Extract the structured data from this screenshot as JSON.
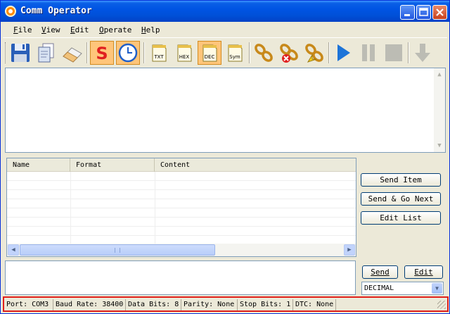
{
  "window": {
    "title": "Comm Operator"
  },
  "menu": [
    "File",
    "View",
    "Edit",
    "Operate",
    "Help"
  ],
  "toolbar": {
    "items": [
      {
        "name": "save-icon"
      },
      {
        "name": "copy-icon"
      },
      {
        "name": "eraser-icon"
      },
      {
        "name": "stop-s-icon",
        "label": "S",
        "active": true
      },
      {
        "name": "timer-clock-icon",
        "active": true
      },
      {
        "name": "txt-format-icon",
        "label": "TXT"
      },
      {
        "name": "hex-format-icon",
        "label": "HEX"
      },
      {
        "name": "dec-format-icon",
        "label": "DEC",
        "active": true
      },
      {
        "name": "sym-format-icon",
        "label": "Sym"
      },
      {
        "name": "connect-chain-icon"
      },
      {
        "name": "disconnect-chain-icon"
      },
      {
        "name": "chain-refresh-icon"
      },
      {
        "name": "play-icon"
      },
      {
        "name": "pause-icon"
      },
      {
        "name": "stop-icon"
      },
      {
        "name": "down-arrow-icon"
      }
    ]
  },
  "list": {
    "columns": [
      "Name",
      "Format",
      "Content"
    ],
    "rows": []
  },
  "side_buttons": {
    "send_item": "Send Item",
    "send_go_next": "Send & Go Next",
    "edit_list": "Edit List",
    "send": "Send",
    "edit": "Edit"
  },
  "combo": {
    "value": "DECIMAL"
  },
  "status": {
    "port": "Port: COM3",
    "baud": "Baud Rate: 38400",
    "data_bits": "Data Bits: 8",
    "parity": "Parity: None",
    "stop_bits": "Stop Bits: 1",
    "dtc": "DTC: None"
  },
  "colors": {
    "titlebar": "#0054e3",
    "face": "#ece9d8",
    "status_border": "#e0201a",
    "active_tool": "#ffc57a"
  }
}
